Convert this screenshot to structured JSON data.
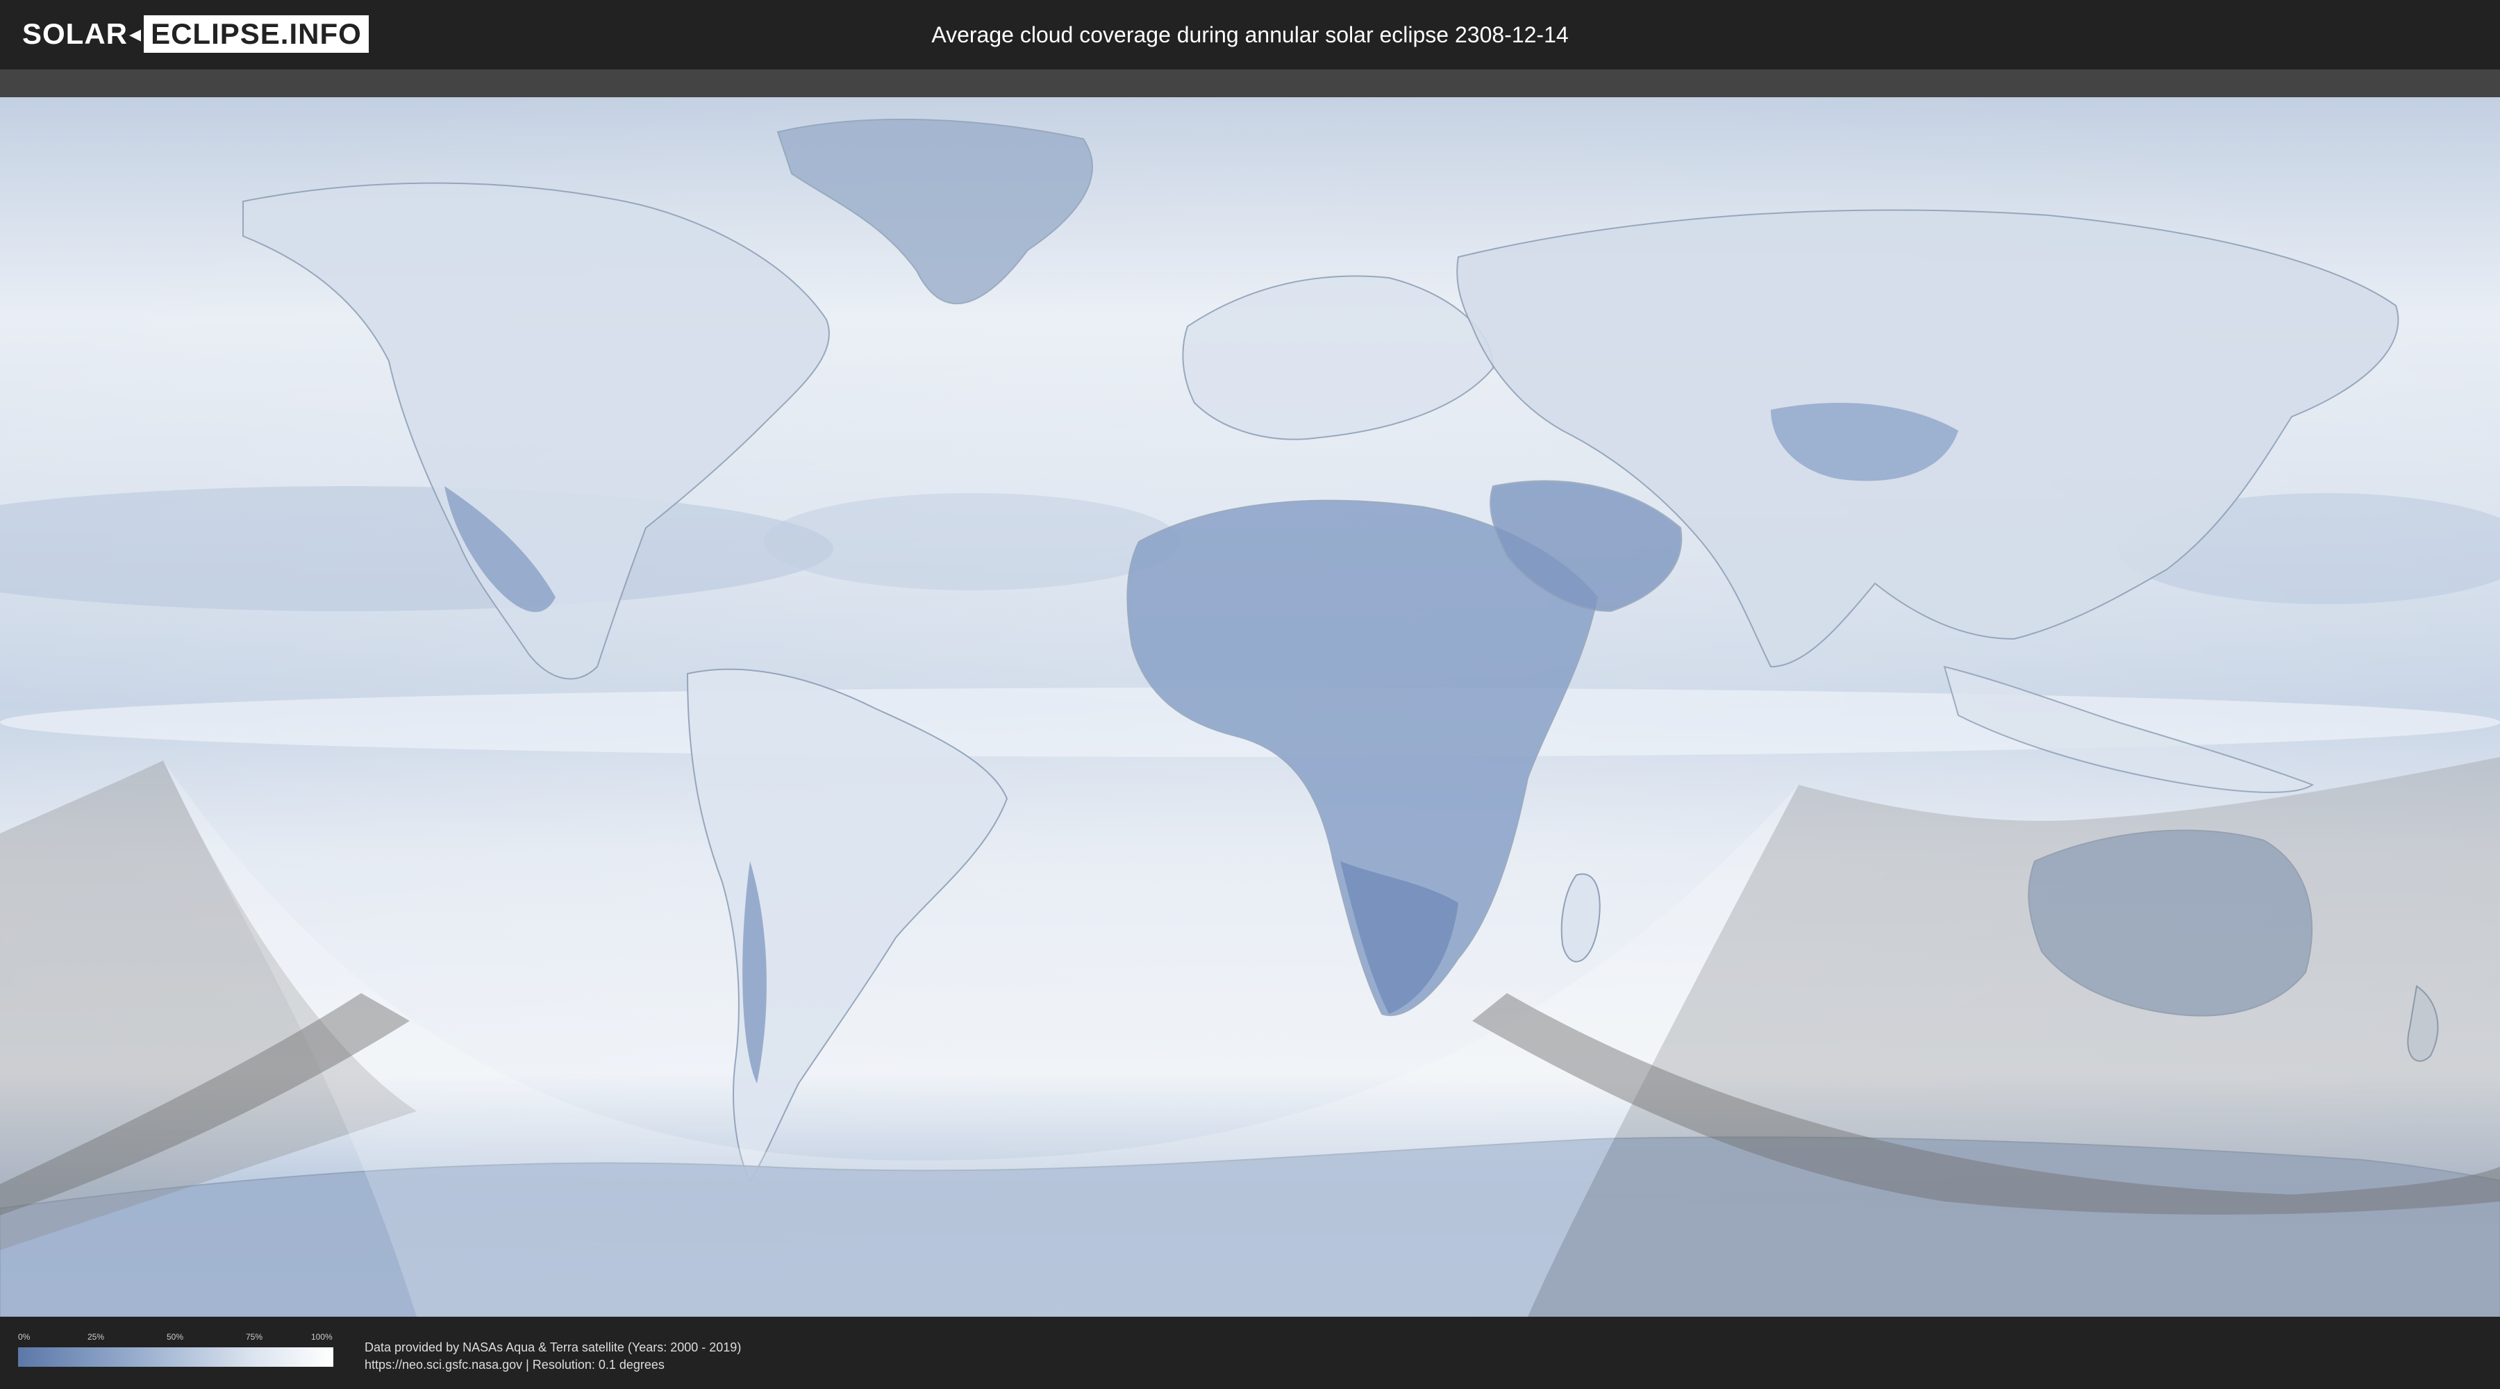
{
  "header": {
    "logo_left": "SOLAR",
    "logo_right": "ECLIPSE.INFO",
    "title": "Average cloud coverage during annular solar eclipse 2308-12-14"
  },
  "legend": {
    "ticks": [
      "0%",
      "25%",
      "50%",
      "75%",
      "100%"
    ],
    "colors": {
      "low": "#5b78a8",
      "high": "#ffffff"
    }
  },
  "credits": {
    "line1": "Data provided by NASAs Aqua & Terra satellite (Years: 2000 - 2019)",
    "line2": "https://neo.sci.gsfc.nasa.gov | Resolution: 0.1 degrees"
  }
}
